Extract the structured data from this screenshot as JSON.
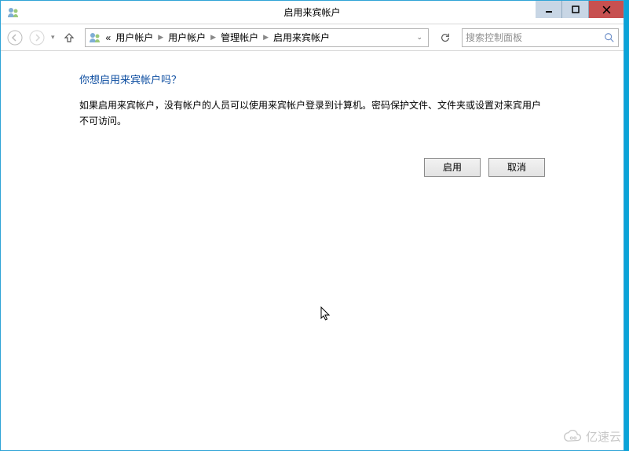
{
  "window": {
    "title": "启用来宾帐户"
  },
  "breadcrumb": {
    "pre": "«",
    "items": [
      "用户帐户",
      "用户帐户",
      "管理帐户",
      "启用来宾帐户"
    ]
  },
  "search": {
    "placeholder": "搜索控制面板"
  },
  "page": {
    "heading": "你想启用来宾帐户吗？",
    "desc": "如果启用来宾帐户，没有帐户的人员可以使用来宾帐户登录到计算机。密码保护文件、文件夹或设置对来宾用户不可访问。"
  },
  "buttons": {
    "enable": "启用",
    "cancel": "取消"
  },
  "watermark": "亿速云"
}
